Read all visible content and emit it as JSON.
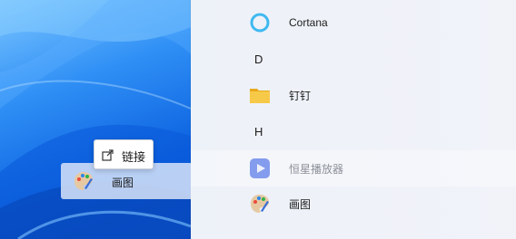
{
  "start_menu": {
    "items": [
      {
        "type": "app",
        "label": "Cortana",
        "icon": "cortana-icon"
      },
      {
        "type": "header",
        "label": "D"
      },
      {
        "type": "app",
        "label": "钉钉",
        "icon": "folder-icon"
      },
      {
        "type": "header",
        "label": "H"
      },
      {
        "type": "app",
        "label": "恒星播放器",
        "icon": "media-player-icon",
        "state": "dragging"
      },
      {
        "type": "app",
        "label": "画图",
        "icon": "paint-icon"
      }
    ]
  },
  "drag_ghost": {
    "label": "画图",
    "icon": "paint-icon"
  },
  "tooltip": {
    "label": "链接",
    "icon": "link-arrow-icon"
  },
  "colors": {
    "accent": "#1e88e5",
    "panel_bg": "#eef2f8",
    "folder": "#f5c13b",
    "cortana_ring": "#3fb9f0"
  }
}
